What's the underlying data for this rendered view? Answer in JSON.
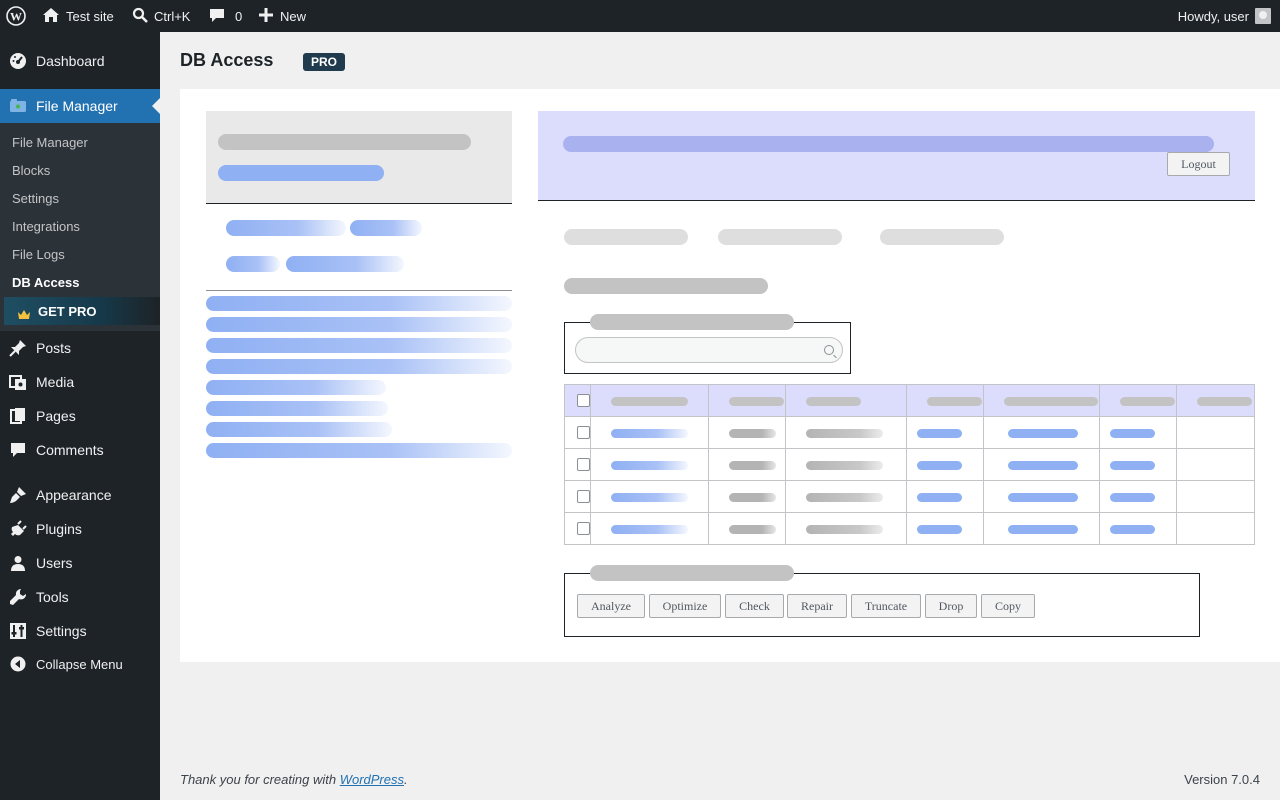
{
  "adminbar": {
    "site_name": "Test site",
    "search_shortcut": "Ctrl+K",
    "comments_count": "0",
    "new_label": "New",
    "howdy": "Howdy, user"
  },
  "sidebar": {
    "items": [
      {
        "label": "Dashboard",
        "icon": "dashboard-icon"
      },
      {
        "label": "File Manager",
        "icon": "file-manager-icon"
      },
      {
        "label": "Posts",
        "icon": "pin-icon"
      },
      {
        "label": "Media",
        "icon": "media-icon"
      },
      {
        "label": "Pages",
        "icon": "pages-icon"
      },
      {
        "label": "Comments",
        "icon": "comment-icon"
      },
      {
        "label": "Appearance",
        "icon": "brush-icon"
      },
      {
        "label": "Plugins",
        "icon": "plug-icon"
      },
      {
        "label": "Users",
        "icon": "user-icon"
      },
      {
        "label": "Tools",
        "icon": "wrench-icon"
      },
      {
        "label": "Settings",
        "icon": "settings-icon"
      }
    ],
    "submenu": [
      "File Manager",
      "Blocks",
      "Settings",
      "Integrations",
      "File Logs",
      "DB Access"
    ],
    "get_pro": "GET PRO",
    "collapse": "Collapse Menu"
  },
  "page": {
    "title": "DB Access",
    "badge": "PRO"
  },
  "db": {
    "logout": "Logout",
    "actions": [
      "Analyze",
      "Optimize",
      "Check",
      "Repair",
      "Truncate",
      "Drop",
      "Copy"
    ]
  },
  "footer": {
    "thanks_prefix": "Thank you for creating with ",
    "thanks_link": "WordPress",
    "thanks_suffix": ".",
    "version": "Version 7.0.4"
  },
  "colors": {
    "admin_dark": "#1d2327",
    "accent": "#2271b1",
    "header_tint": "#dcdcfc"
  }
}
